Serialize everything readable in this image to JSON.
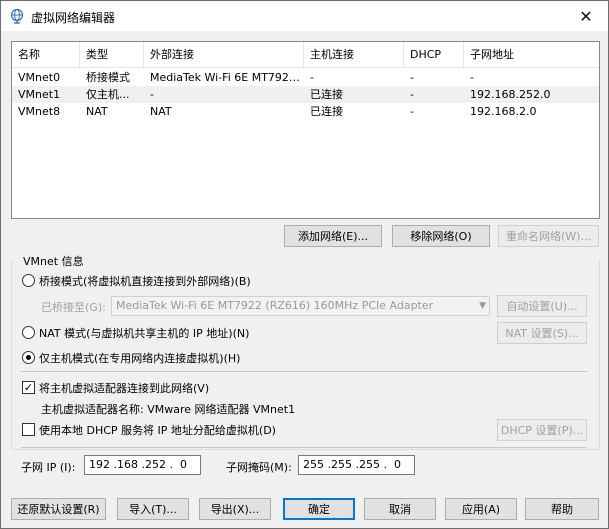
{
  "window": {
    "title": "虚拟网络编辑器",
    "close_glyph": "✕"
  },
  "table": {
    "columns": [
      "名称",
      "类型",
      "外部连接",
      "主机连接",
      "DHCP",
      "子网地址"
    ],
    "rows": [
      [
        "VMnet0",
        "桥接模式",
        "MediaTek Wi-Fi 6E MT7922 (...",
        "-",
        "-",
        "-"
      ],
      [
        "VMnet1",
        "仅主机...",
        "-",
        "已连接",
        "-",
        "192.168.252.0"
      ],
      [
        "VMnet8",
        "NAT",
        "NAT",
        "已连接",
        "-",
        "192.168.2.0"
      ]
    ],
    "selected_row": 1
  },
  "table_buttons": {
    "add": "添加网络(E)...",
    "remove": "移除网络(O)",
    "rename": "重命名网络(W)..."
  },
  "vmnet_info": {
    "group_label": "VMnet 信息",
    "bridged_label": "桥接模式(将虚拟机直接连接到外部网络)(B)",
    "bridged_to_label": "已桥接至(G):",
    "bridged_to_value": "MediaTek Wi-Fi 6E MT7922 (RZ616) 160MHz PCIe Adapter",
    "auto_settings": "自动设置(U)...",
    "nat_label": "NAT 模式(与虚拟机共享主机的 IP 地址)(N)",
    "nat_settings": "NAT 设置(S)...",
    "hostonly_label": "仅主机模式(在专用网络内连接虚拟机)(H)",
    "connect_adapter_label": "将主机虚拟适配器连接到此网络(V)",
    "adapter_name_text": "主机虚拟适配器名称: VMware 网络适配器 VMnet1",
    "dhcp_label": "使用本地 DHCP 服务将 IP 地址分配给虚拟机(D)",
    "dhcp_settings": "DHCP 设置(P)...",
    "subnet_ip_label": "子网 IP (I):",
    "subnet_ip_value": "192 .168 .252 .  0",
    "subnet_mask_label": "子网掩码(M):",
    "subnet_mask_value": "255 .255 .255 .  0",
    "selected_mode": "hostonly",
    "connect_adapter_checked": true,
    "dhcp_checked": false
  },
  "footer_buttons": {
    "restore": "还原默认设置(R)",
    "import": "导入(T)...",
    "export": "导出(X)...",
    "ok": "确定",
    "cancel": "取消",
    "apply": "应用(A)",
    "help": "帮助"
  }
}
